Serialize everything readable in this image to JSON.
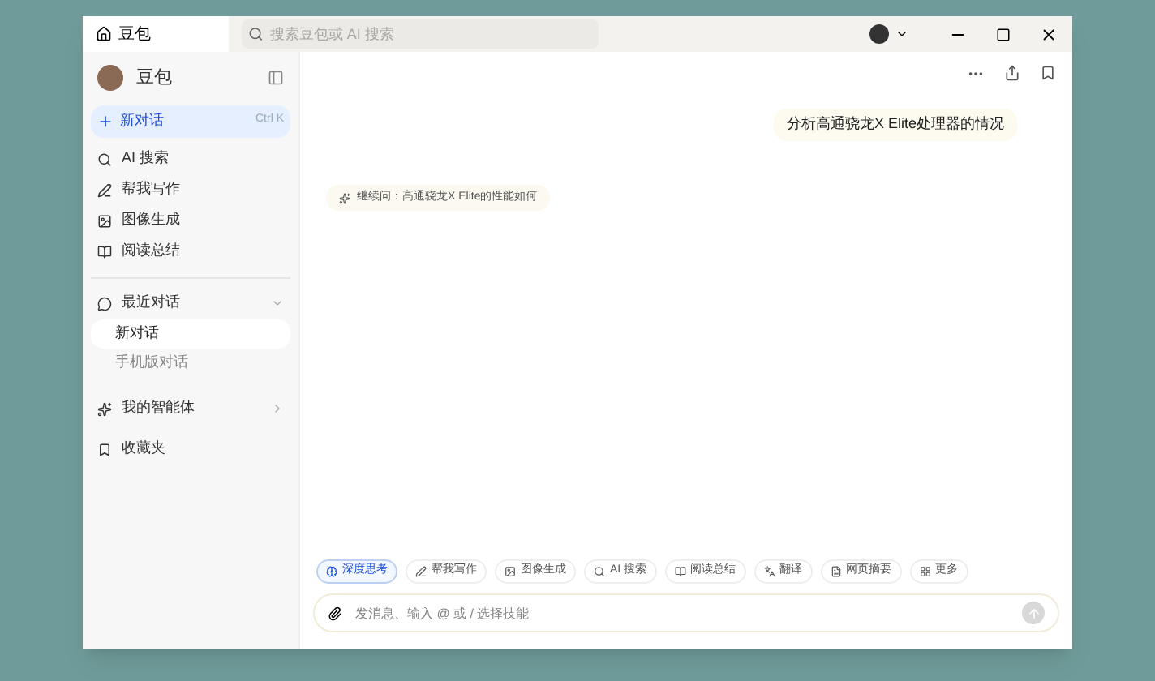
{
  "title_bar": {
    "tab": "豆包",
    "search": {
      "placeholder": "搜索豆包或 AI 搜索"
    }
  },
  "sidebar": {
    "app_name": "豆包",
    "new_chat": {
      "label": "新对话",
      "shortcut": "Ctrl K"
    },
    "items": [
      {
        "label": "AI 搜索"
      },
      {
        "label": "帮我写作"
      },
      {
        "label": "图像生成"
      },
      {
        "label": "阅读总结"
      }
    ],
    "recent": {
      "label": "最近对话",
      "expanded": true,
      "chats": [
        {
          "label": "新对话",
          "selected": true
        },
        {
          "label": "手机版对话",
          "selected": false
        }
      ]
    },
    "agents": {
      "label": "我的智能体"
    },
    "favorites": {
      "label": "收藏夹"
    }
  },
  "chat": {
    "messages": [
      {
        "text": "分析高通骁龙X Elite处理器的情况"
      }
    ],
    "suggestion": "继续问：高通骁龙X Elite的性能如何"
  },
  "skills": [
    {
      "label": "深度思考",
      "selected": true
    },
    {
      "label": "帮我写作",
      "selected": false
    },
    {
      "label": "图像生成",
      "selected": false
    },
    {
      "label": "AI 搜索",
      "selected": false
    },
    {
      "label": "阅读总结",
      "selected": false
    },
    {
      "label": "翻译",
      "selected": false
    },
    {
      "label": "网页摘要",
      "selected": false
    },
    {
      "label": "更多",
      "selected": false
    }
  ],
  "composer": {
    "placeholder": "发消息、输入 @ 或 / 选择技能"
  }
}
